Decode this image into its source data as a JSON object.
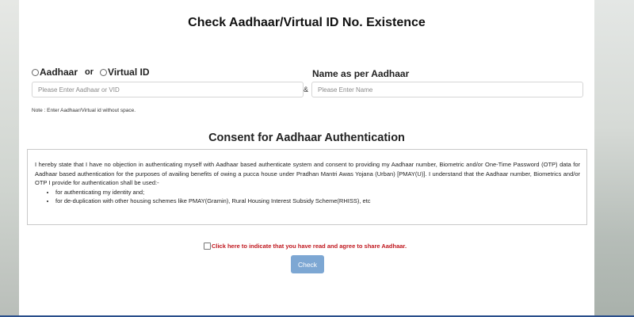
{
  "page": {
    "title": "Check Aadhaar/Virtual ID No. Existence"
  },
  "form": {
    "id_type": {
      "option_aadhaar": "Aadhaar",
      "or_text": "or",
      "option_virtual_id": "Virtual ID",
      "selected": null
    },
    "id_input": {
      "placeholder": "Please Enter Aadhaar or VID",
      "value": ""
    },
    "ampersand": "&",
    "name_label": "Name as per Aadhaar",
    "name_input": {
      "placeholder": "Please Enter Name",
      "value": ""
    },
    "note": "Note : Enter Aadhaar/Virtual id without space."
  },
  "consent": {
    "title": "Consent for Aadhaar Authentication",
    "paragraph": "I hereby state that I have no objection in authenticating myself with Aadhaar based authenticate system and consent to providing my Aadhaar number, Biometric and/or One-Time Password (OTP) data for Aadhaar based authentication for the purposes of availing benefits of owing a pucca house under Pradhan Mantri Awas Yojana (Urban) [PMAY(U)]. I understand that the Aadhaar number, Biometrics and/or OTP I provide for authentication shall be used:-",
    "items": [
      "for authenticating my identity and;",
      "for de-duplication with other housing schemes like PMAY(Gramin), Rural Housing Interest Subsidy Scheme(RHISS), etc"
    ],
    "agree_label": "Click here to indicate that you have read and agree to share Aadhaar.",
    "agree_checked": false
  },
  "actions": {
    "check_label": "Check"
  },
  "colors": {
    "agree_text": "#c0181f",
    "check_button": "#7da7d3",
    "bottom_strip": "#2a4f8c"
  }
}
